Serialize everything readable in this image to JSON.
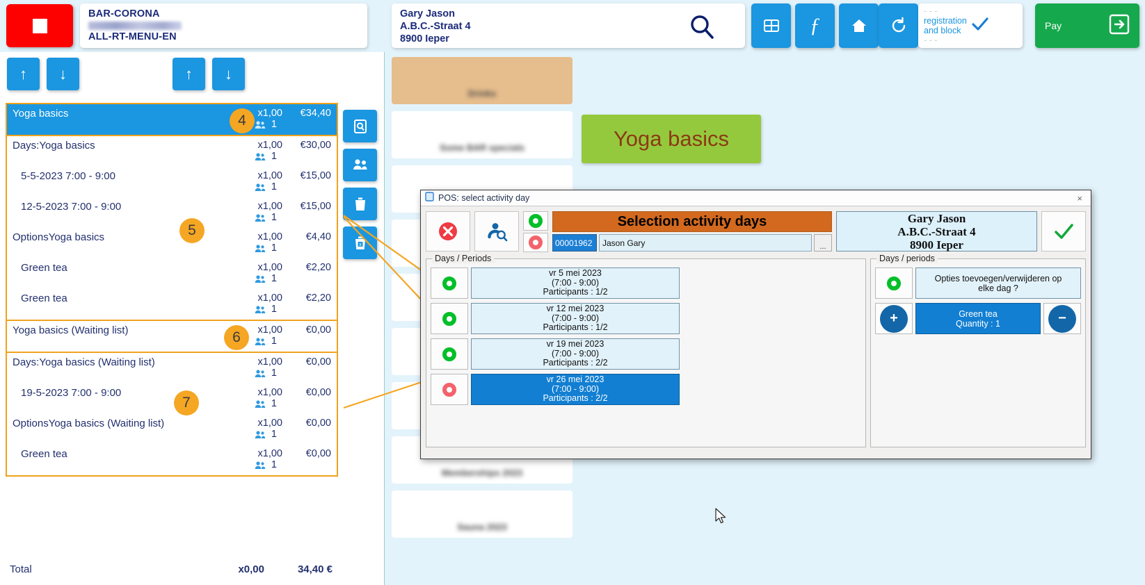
{
  "header": {
    "store": {
      "line1": "BAR-CORONA",
      "line2_blurred": true,
      "line3": "ALL-RT-MENU-EN"
    },
    "customer": {
      "name": "Gary  Jason",
      "street": "A.B.C.-Straat 4",
      "city": "8900 Ieper"
    },
    "search_icon": "search-icon",
    "buttons": [
      {
        "name": "grid-button",
        "icon": "grid-icon"
      },
      {
        "name": "function-button",
        "icon": "function-icon"
      },
      {
        "name": "home-button",
        "icon": "home-icon"
      },
      {
        "name": "refresh-button",
        "icon": "refresh-icon"
      }
    ],
    "registration_block": {
      "line_top": "- - -",
      "line1": "registration",
      "line2": "and block",
      "line_bottom": "- - -",
      "check_icon": "check-icon"
    },
    "pay": {
      "label": "Pay",
      "icon": "arrow-right-icon",
      "color": "#16a84c"
    }
  },
  "left_panel": {
    "nav": [
      {
        "name": "scroll-up-button",
        "icon": "arrow-up-icon"
      },
      {
        "name": "scroll-down-button",
        "icon": "arrow-down-icon"
      },
      {
        "name": "line-up-button",
        "icon": "arrow-up-icon"
      },
      {
        "name": "line-down-button",
        "icon": "arrow-down-icon"
      }
    ],
    "side_buttons": [
      {
        "name": "search-ticket-button",
        "icon": "search-doc-icon"
      },
      {
        "name": "participants-button",
        "icon": "people-icon"
      },
      {
        "name": "delete-button",
        "icon": "trash-icon"
      },
      {
        "name": "delete-all-button",
        "icon": "trash-x-icon"
      }
    ],
    "groups": [
      {
        "badge": "4",
        "rows": [
          {
            "name": "Yoga basics",
            "qty": "x1,00",
            "amount": "€34,40",
            "people": "1",
            "selected": true,
            "indent": 0
          }
        ]
      },
      {
        "badge": "5",
        "rows": [
          {
            "name": "Days:Yoga basics",
            "qty": "x1,00",
            "amount": "€30,00",
            "people": "1",
            "selected": false,
            "indent": 0
          },
          {
            "name": "5-5-2023 7:00 - 9:00",
            "qty": "x1,00",
            "amount": "€15,00",
            "people": "1",
            "selected": false,
            "indent": 1
          },
          {
            "name": "12-5-2023 7:00 - 9:00",
            "qty": "x1,00",
            "amount": "€15,00",
            "people": "1",
            "selected": false,
            "indent": 1
          },
          {
            "name": "OptionsYoga basics",
            "qty": "x1,00",
            "amount": "€4,40",
            "people": "1",
            "selected": false,
            "indent": 0
          },
          {
            "name": "Green tea",
            "qty": "x1,00",
            "amount": "€2,20",
            "people": "1",
            "selected": false,
            "indent": 1
          },
          {
            "name": "Green tea",
            "qty": "x1,00",
            "amount": "€2,20",
            "people": "1",
            "selected": false,
            "indent": 1
          }
        ]
      },
      {
        "badge": "6",
        "rows": [
          {
            "name": "Yoga basics (Waiting list)",
            "qty": "x1,00",
            "amount": "€0,00",
            "people": "1",
            "selected": false,
            "indent": 0
          }
        ]
      },
      {
        "badge": "7",
        "rows": [
          {
            "name": "Days:Yoga basics (Waiting list)",
            "qty": "x1,00",
            "amount": "€0,00",
            "people": "1",
            "selected": false,
            "indent": 0
          },
          {
            "name": "19-5-2023 7:00 - 9:00",
            "qty": "x1,00",
            "amount": "€0,00",
            "people": "1",
            "selected": false,
            "indent": 1
          },
          {
            "name": "OptionsYoga basics (Waiting list)",
            "qty": "x1,00",
            "amount": "€0,00",
            "people": "1",
            "selected": false,
            "indent": 0
          },
          {
            "name": "Green tea",
            "qty": "x1,00",
            "amount": "€0,00",
            "people": "1",
            "selected": false,
            "indent": 1
          }
        ]
      }
    ],
    "total": {
      "label": "Total",
      "qty": "x0,00",
      "amount": "34,40 €"
    }
  },
  "background": {
    "product_button": {
      "label": "Yoga basics",
      "bg": "#95c93d",
      "fg": "#8b3a14"
    },
    "tiles": [
      {
        "blurred": true,
        "tan": true
      },
      {
        "blurred": true,
        "tan": false
      },
      {
        "blurred": true,
        "tan": false
      },
      {
        "blurred": true,
        "tan": false
      },
      {
        "blurred": true,
        "tan": false
      },
      {
        "blurred": true,
        "tan": false
      },
      {
        "blurred": true,
        "tan": false
      },
      {
        "blurred": true,
        "tan": false
      },
      {
        "blurred": true,
        "tan": false
      }
    ]
  },
  "modal": {
    "window_title": "POS: select activity day",
    "close_label": "×",
    "toolbar": [
      {
        "name": "cancel-button",
        "icon": "red-x-icon"
      },
      {
        "name": "search-person-button",
        "icon": "person-search-icon"
      }
    ],
    "radio_top": "green-ring-icon",
    "radio_bottom": "red-ring-icon",
    "banner": "Selection activity days",
    "customer_id": "00001962",
    "customer_name": "Jason Gary",
    "browse_label": "...",
    "customer_box": {
      "name": "Gary Jason",
      "street": "A.B.C.-Straat 4",
      "city": "8900 Ieper"
    },
    "confirm_icon": "green-check-icon",
    "left_pane": {
      "legend": "Days / Periods",
      "days": [
        {
          "date": "vr 5 mei 2023",
          "time": "(7:00 - 9:00)",
          "participants": "Participants : 1/2",
          "state": "green",
          "selected": false
        },
        {
          "date": "vr 12 mei 2023",
          "time": "(7:00 - 9:00)",
          "participants": "Participants : 1/2",
          "state": "green",
          "selected": false
        },
        {
          "date": "vr 19 mei 2023",
          "time": "(7:00 - 9:00)",
          "participants": "Participants : 2/2",
          "state": "green",
          "selected": false
        },
        {
          "date": "vr 26 mei 2023",
          "time": "(7:00 - 9:00)",
          "participants": "Participants : 2/2",
          "state": "red",
          "selected": true
        }
      ]
    },
    "right_pane": {
      "legend": "Days / periods",
      "question": {
        "line1": "Opties toevoegen/verwijderen op",
        "line2": "elke dag ?",
        "state": "green"
      },
      "option": {
        "line1": "Green tea",
        "line2": "Quantity : 1",
        "plus": "+",
        "minus": "−",
        "selected": true
      }
    }
  }
}
